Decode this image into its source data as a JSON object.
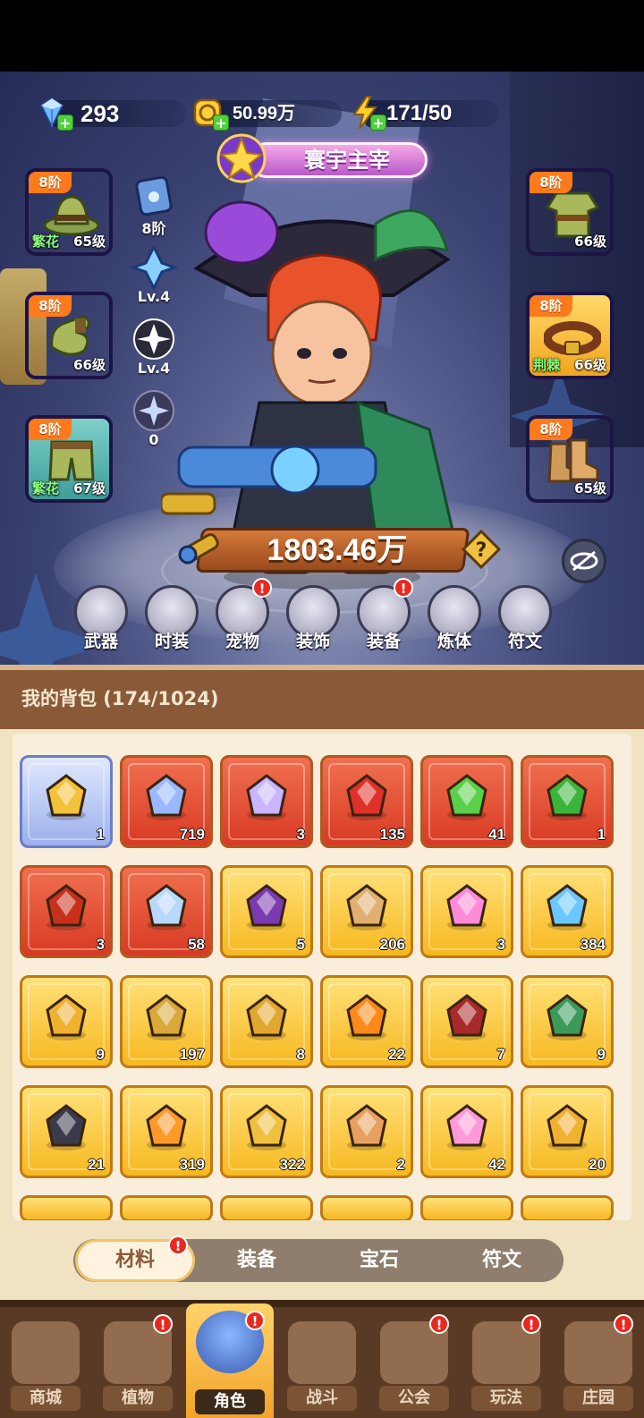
{
  "resources": {
    "diamonds": "293",
    "gold": "50.99万",
    "energy": "171/50"
  },
  "title": "寰宇主宰",
  "equipment_left": [
    {
      "tier": "8阶",
      "set": "繁花",
      "level": "65级",
      "color": "purple"
    },
    {
      "tier": "8阶",
      "set": "",
      "level": "66级",
      "color": "purple"
    },
    {
      "tier": "8阶",
      "set": "繁花",
      "level": "67级",
      "color": "green"
    }
  ],
  "equipment_right": [
    {
      "tier": "8阶",
      "set": "",
      "level": "66级",
      "color": "purple"
    },
    {
      "tier": "8阶",
      "set": "荆棘",
      "level": "66级",
      "color": "gold"
    },
    {
      "tier": "8阶",
      "set": "",
      "level": "65级",
      "color": "purple"
    }
  ],
  "stats": [
    "8阶",
    "Lv.4",
    "Lv.4",
    "0"
  ],
  "power": "1803.46万",
  "functions": [
    {
      "label": "武器",
      "icon": "sword-icon",
      "badge": false
    },
    {
      "label": "时装",
      "icon": "coat-icon",
      "badge": false
    },
    {
      "label": "宠物",
      "icon": "cat-icon",
      "badge": true
    },
    {
      "label": "装饰",
      "icon": "mask-icon",
      "badge": false
    },
    {
      "label": "装备",
      "icon": "hammer-icon",
      "badge": true
    },
    {
      "label": "炼体",
      "icon": "body-icon",
      "badge": false
    },
    {
      "label": "符文",
      "icon": "rune-icon",
      "badge": false
    }
  ],
  "bag": {
    "title": "我的背包 (174/1024)",
    "items": [
      {
        "icon": "potion-vial-icon",
        "count": "1",
        "color": "blue"
      },
      {
        "icon": "star-crystal-icon",
        "count": "719",
        "color": "red"
      },
      {
        "icon": "moon-star-icon",
        "count": "3",
        "color": "red"
      },
      {
        "icon": "red-potion-icon",
        "count": "135",
        "color": "red"
      },
      {
        "icon": "green-tube-icon",
        "count": "41",
        "color": "red"
      },
      {
        "icon": "green-capsule-icon",
        "count": "1",
        "color": "red"
      },
      {
        "icon": "red-scroll-icon",
        "count": "3",
        "color": "red"
      },
      {
        "icon": "hexagram-crystal-icon",
        "count": "58",
        "color": "red"
      },
      {
        "icon": "skull-scroll-icon",
        "count": "5",
        "color": "yellow"
      },
      {
        "icon": "book-icon",
        "count": "206",
        "color": "yellow"
      },
      {
        "icon": "heart-wing-icon",
        "count": "3",
        "color": "yellow"
      },
      {
        "icon": "blue-star-icon",
        "count": "384",
        "color": "yellow"
      },
      {
        "icon": "ruby-key-icon",
        "count": "9",
        "color": "yellow"
      },
      {
        "icon": "purple-key-icon",
        "count": "197",
        "color": "yellow"
      },
      {
        "icon": "emerald-key-icon",
        "count": "8",
        "color": "yellow"
      },
      {
        "icon": "fire-prism-icon",
        "count": "22",
        "color": "yellow"
      },
      {
        "icon": "red-tome-icon",
        "count": "7",
        "color": "yellow"
      },
      {
        "icon": "green-cube-icon",
        "count": "9",
        "color": "yellow"
      },
      {
        "icon": "dark-rune-icon",
        "count": "21",
        "color": "yellow"
      },
      {
        "icon": "orange-potion-icon",
        "count": "319",
        "color": "yellow"
      },
      {
        "icon": "gold-pile-icon",
        "count": "322",
        "color": "yellow"
      },
      {
        "icon": "cake-icon",
        "count": "2",
        "color": "yellow"
      },
      {
        "icon": "pink-crystal-icon",
        "count": "42",
        "color": "yellow"
      },
      {
        "icon": "gold-ring-icon",
        "count": "20",
        "color": "yellow"
      }
    ]
  },
  "tabs": [
    {
      "label": "材料",
      "active": true,
      "badge": true
    },
    {
      "label": "装备",
      "active": false,
      "badge": false
    },
    {
      "label": "宝石",
      "active": false,
      "badge": false
    },
    {
      "label": "符文",
      "active": false,
      "badge": false
    }
  ],
  "nav": [
    {
      "label": "商城",
      "icon": "shop-icon",
      "badge": false,
      "active": false
    },
    {
      "label": "植物",
      "icon": "plant-icon",
      "badge": true,
      "active": false
    },
    {
      "label": "角色",
      "icon": "character-icon",
      "badge": true,
      "active": true
    },
    {
      "label": "战斗",
      "icon": "battle-icon",
      "badge": false,
      "active": false
    },
    {
      "label": "公会",
      "icon": "guild-icon",
      "badge": true,
      "active": false
    },
    {
      "label": "玩法",
      "icon": "gameplay-icon",
      "badge": true,
      "active": false
    },
    {
      "label": "庄园",
      "icon": "manor-icon",
      "badge": true,
      "active": false
    }
  ],
  "badge_mark": "!"
}
